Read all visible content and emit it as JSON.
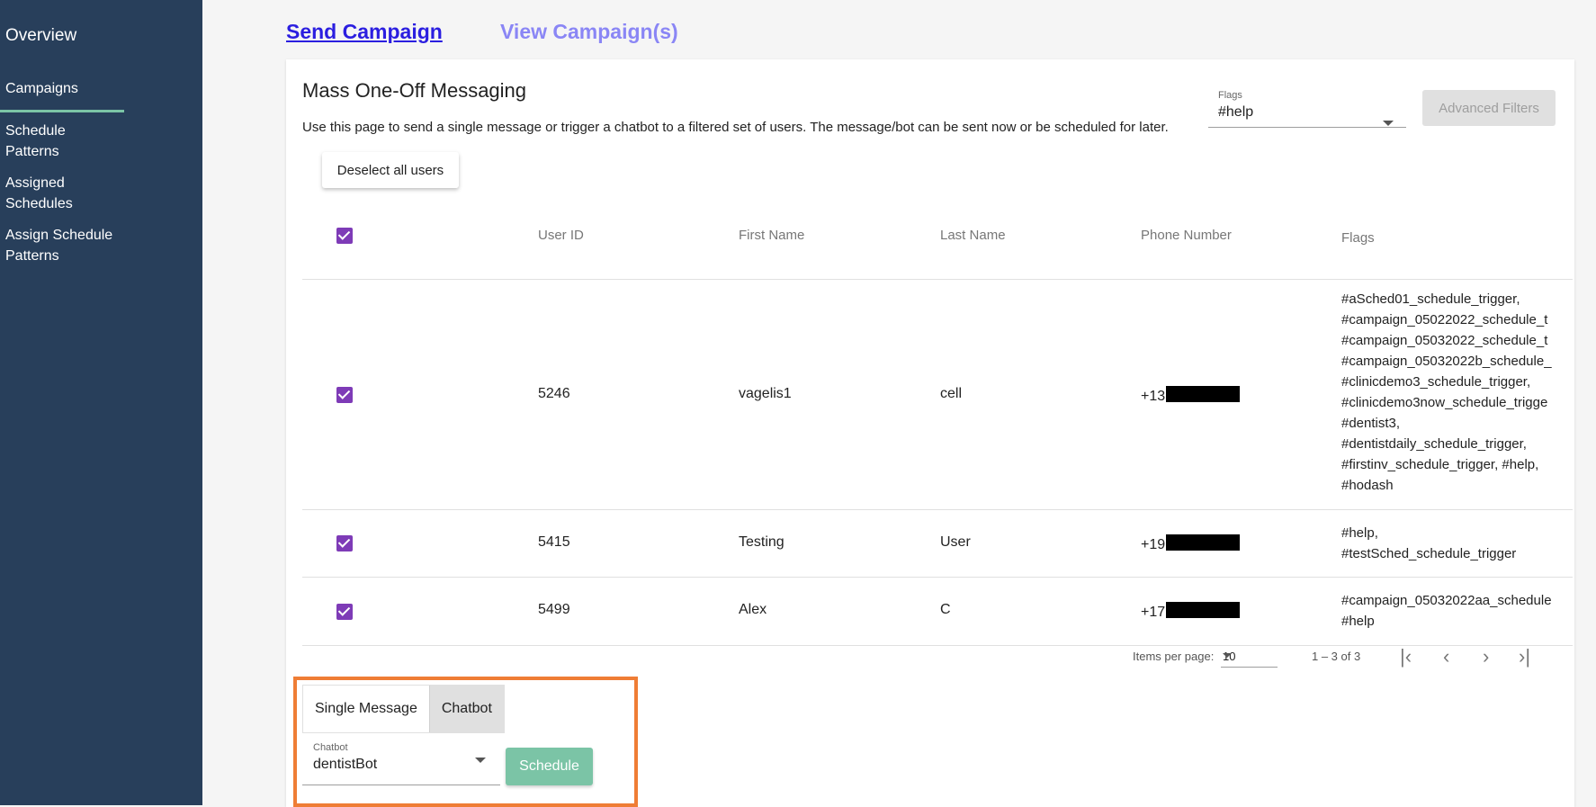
{
  "sidebar": {
    "overview": "Overview",
    "campaigns": "Campaigns",
    "schedule_patterns": [
      "Schedule",
      "Patterns"
    ],
    "assigned_schedules": [
      "Assigned",
      "Schedules"
    ],
    "assign_schedule_patterns": [
      "Assign Schedule",
      "Patterns"
    ]
  },
  "tabs": {
    "send": "Send Campaign",
    "view": "View Campaign(s)"
  },
  "card": {
    "title": "Mass One-Off Messaging",
    "description": "Use this page to send a single message or trigger a chatbot to a filtered set of users. The message/bot can be sent now or be scheduled for later.",
    "flags_label": "Flags",
    "flags_value": "#help",
    "advanced_filters": "Advanced Filters",
    "deselect_all": "Deselect all users"
  },
  "table": {
    "headers": [
      "User ID",
      "First Name",
      "Last Name",
      "Phone Number",
      "Flags"
    ],
    "rows": [
      {
        "user_id": "5246",
        "first": "vagelis1",
        "last": "cell",
        "phone_prefix": "+13",
        "flags": [
          "#aSched01_schedule_trigger,",
          "#campaign_05022022_schedule_t",
          "#campaign_05032022_schedule_t",
          "#campaign_05032022b_schedule_",
          "#clinicdemo3_schedule_trigger,",
          "#clinicdemo3now_schedule_trigge",
          "#dentist3,",
          "#dentistdaily_schedule_trigger,",
          "#firstinv_schedule_trigger, #help,",
          "#hodash"
        ]
      },
      {
        "user_id": "5415",
        "first": "Testing",
        "last": "User",
        "phone_prefix": "+19",
        "flags": [
          "#help,",
          "#testSched_schedule_trigger"
        ]
      },
      {
        "user_id": "5499",
        "first": "Alex",
        "last": "C",
        "phone_prefix": "+17",
        "flags": [
          "#campaign_05032022aa_schedule",
          "#help"
        ]
      }
    ]
  },
  "paginator": {
    "items_per_page_label": "Items per page:",
    "items_per_page": "10",
    "range": "1 – 3 of 3"
  },
  "send_panel": {
    "tab_single": "Single Message",
    "tab_chatbot": "Chatbot",
    "chatbot_label": "Chatbot",
    "chatbot_value": "dentistBot",
    "schedule_button": "Schedule"
  }
}
